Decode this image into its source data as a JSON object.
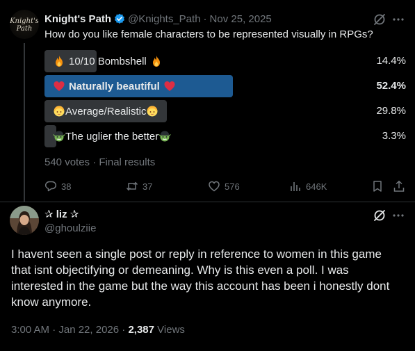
{
  "tweet": {
    "author_name": "Knight's Path",
    "handle": "@Knights_Path",
    "date": "Nov 25, 2025",
    "avatar_text_1": "Knight's",
    "avatar_text_2": "Path",
    "question": "How do you like female characters to be represented visually in RPGs?",
    "poll": [
      {
        "label": "10/10 Bombshell",
        "percent_text": "14.4%",
        "fraction": 0.144,
        "icon": "fire-emoji",
        "winner": false
      },
      {
        "label": "Naturally beautiful",
        "percent_text": "52.4%",
        "fraction": 0.524,
        "icon": "red-heart-emoji",
        "winner": true
      },
      {
        "label": "Average/Realistic",
        "percent_text": "29.8%",
        "fraction": 0.298,
        "icon": "blonde-person-emoji",
        "winner": false
      },
      {
        "label": "The uglier the better",
        "percent_text": "3.3%",
        "fraction": 0.033,
        "icon": "goblin-emoji",
        "winner": false
      }
    ],
    "results_text": "540 votes · Final results",
    "actions": {
      "replies": "38",
      "reposts": "37",
      "likes": "576",
      "views": "646K"
    }
  },
  "reply": {
    "author_name": "✰ liz ✰",
    "handle": "@ghoulziie",
    "text": "I havent seen a single post or reply in reference to women in this game that isnt objectifying or demeaning. Why is this even a poll. I was interested in the game but the way this account has been i honestly dont know anymore.",
    "time": "3:00 AM · Jan 22, 2026 ·",
    "views_count": "2,387",
    "views_label": "Views"
  },
  "colors": {
    "background": "#000000",
    "text": "#e7e9ea",
    "muted": "#71767b",
    "poll_bar": "#333639",
    "poll_winner": "#1d5a92",
    "verified": "#1d9bf0"
  }
}
